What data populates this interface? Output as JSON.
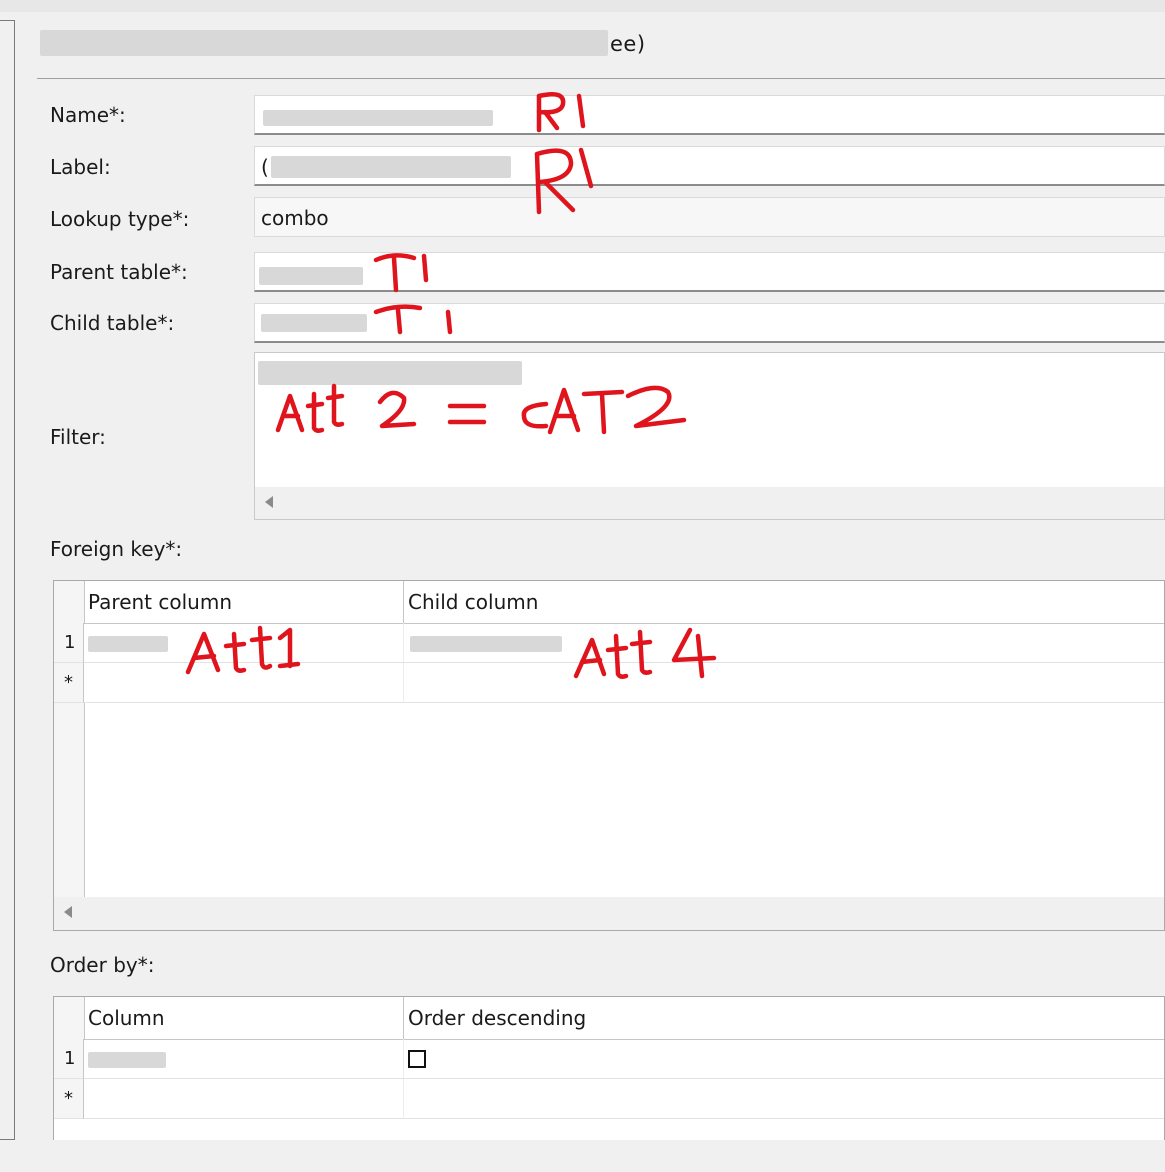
{
  "window": {
    "title_suffix": "ee)"
  },
  "form": {
    "name_label": "Name*:",
    "label_label": "Label:",
    "label_value": "(",
    "lookup_type_label": "Lookup type*:",
    "lookup_type_value": "combo",
    "parent_table_label": "Parent table*:",
    "child_table_label": "Child table*:",
    "filter_label": "Filter:",
    "foreign_key_label": "Foreign key*:",
    "order_by_label": "Order by*:"
  },
  "foreign_key_grid": {
    "columns": [
      "Parent column",
      "Child column"
    ],
    "rows": [
      {
        "row_header": "1"
      },
      {
        "row_header": "*"
      }
    ]
  },
  "order_by_grid": {
    "columns": [
      "Column",
      "Order descending"
    ],
    "rows": [
      {
        "row_header": "1",
        "order_descending": false
      },
      {
        "row_header": "*"
      }
    ]
  },
  "annotations": [
    "R1",
    "R1",
    "T1",
    "T1",
    "Att 2 = CAT2",
    "Att1",
    "Att 4"
  ],
  "colors": {
    "annotation": "#e0141c",
    "redaction": "#d8d8d8"
  }
}
